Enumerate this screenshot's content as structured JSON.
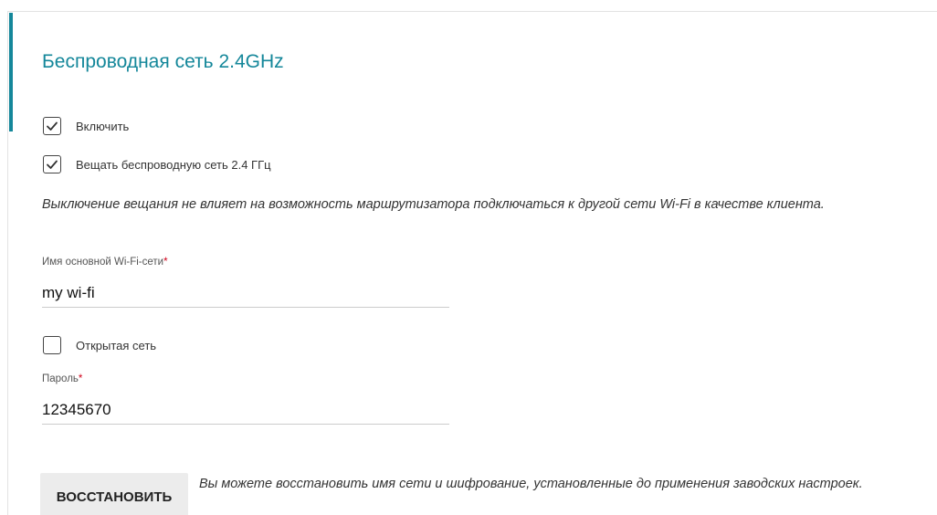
{
  "section": {
    "title": "Беспроводная сеть 2.4GHz"
  },
  "options": {
    "enable": {
      "label": "Включить",
      "checked": true
    },
    "broadcast": {
      "label": "Вещать беспроводную сеть 2.4 ГГц",
      "checked": true
    },
    "open_network": {
      "label": "Открытая сеть",
      "checked": false
    }
  },
  "broadcast_note": "Выключение вещания не влияет на возможность маршрутизатора подключаться к другой сети Wi-Fi в качестве клиента.",
  "ssid_field": {
    "label": "Имя основной Wi-Fi-сети",
    "required_mark": "*",
    "value": "my wi-fi"
  },
  "password_field": {
    "label": "Пароль",
    "required_mark": "*",
    "value": "12345670"
  },
  "restore": {
    "button_label": "ВОССТАНОВИТЬ",
    "note": "Вы можете восстановить имя сети и шифрование, установленные до применения заводских настроек."
  },
  "colors": {
    "accent": "#14879a",
    "required": "#d0021b",
    "button_bg": "#ececec"
  },
  "icons": {
    "checked": "checkmark-icon"
  }
}
